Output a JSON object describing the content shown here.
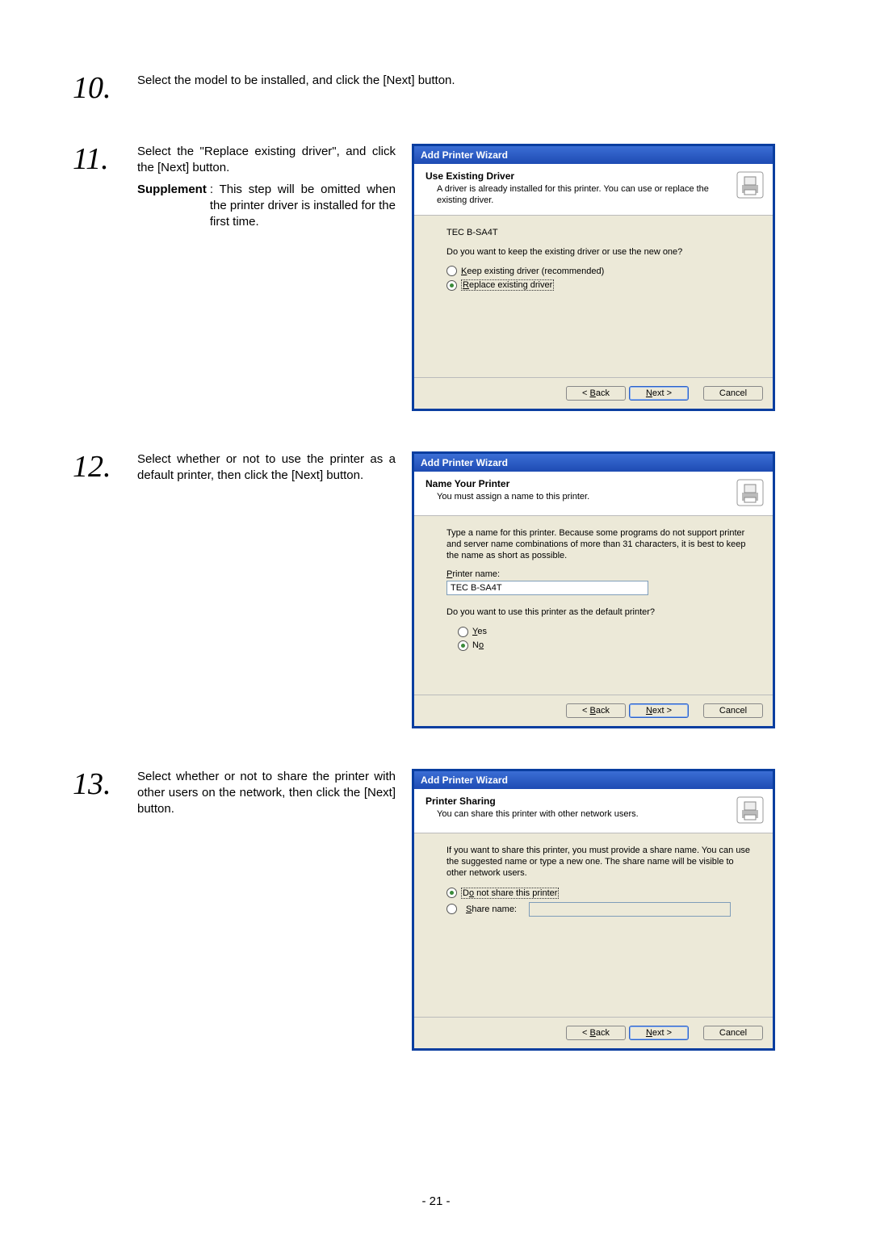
{
  "page_number": "- 21 -",
  "steps": {
    "s10": {
      "num": "10.",
      "text": "Select the model to be installed, and click the [Next] button."
    },
    "s11": {
      "num": "11.",
      "text_line1": "Select the \"Replace existing driver\", and click the [Next] button.",
      "supplement_label": "Supplement",
      "supplement_text": ": This step will be omitted when the printer driver is installed for the first time."
    },
    "s12": {
      "num": "12.",
      "text": "Select whether or not to use the printer as a default printer, then click the [Next] button."
    },
    "s13": {
      "num": "13.",
      "text": "Select whether or not to share the printer with other users on the network, then click the [Next] button."
    }
  },
  "wizard_common": {
    "title": "Add Printer Wizard",
    "back": "< Back",
    "next": "Next >",
    "cancel": "Cancel"
  },
  "wizard11": {
    "hdr_title": "Use Existing Driver",
    "hdr_sub": "A driver is already installed for this printer. You can use or replace the existing driver.",
    "model": "TEC B-SA4T",
    "question": "Do you want to keep the existing driver or use the new one?",
    "opt_keep": "Keep existing driver (recommended)",
    "opt_replace": "Replace existing driver"
  },
  "wizard12": {
    "hdr_title": "Name Your Printer",
    "hdr_sub": "You must assign a name to this printer.",
    "body_text": "Type a name for this printer. Because some programs do not support printer and server name combinations of more than 31 characters, it is best to keep the name as short as possible.",
    "name_label": "Printer name:",
    "name_value": "TEC B-SA4T",
    "default_q": "Do you want to use this printer as the default printer?",
    "opt_yes": "Yes",
    "opt_no": "No"
  },
  "wizard13": {
    "hdr_title": "Printer Sharing",
    "hdr_sub": "You can share this printer with other network users.",
    "body_text": "If you want to share this printer, you must provide a share name. You can use the suggested name or type a new one. The share name will be visible to other network users.",
    "opt_noshare": "Do not share this printer",
    "opt_share": "Share name:",
    "share_value": ""
  }
}
